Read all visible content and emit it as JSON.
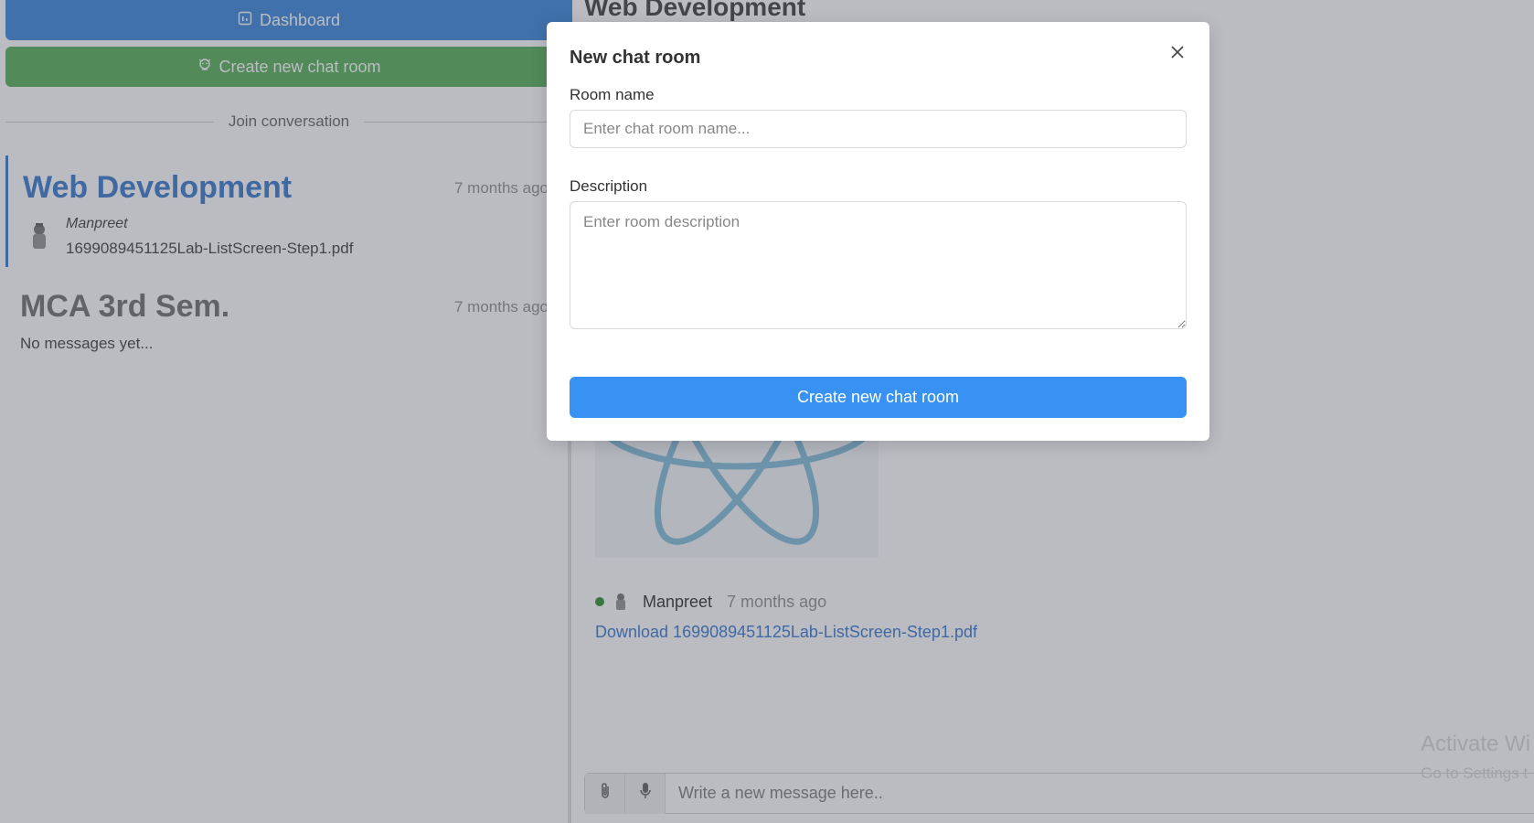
{
  "sidebar": {
    "dashboard_label": "Dashboard",
    "create_label": "Create new chat room",
    "divider_label": "Join conversation",
    "rooms": [
      {
        "title": "Web Development",
        "time": "7 months ago",
        "sender": "Manpreet",
        "last_message": "1699089451125Lab-ListScreen-Step1.pdf"
      },
      {
        "title": "MCA 3rd Sem.",
        "time": "7 months ago",
        "last_message": "No messages yet..."
      }
    ]
  },
  "chat": {
    "title": "Web Development",
    "message": {
      "sender": "Manpreet",
      "time": "7 months ago",
      "link": "Download 1699089451125Lab-ListScreen-Step1.pdf"
    },
    "composer_placeholder": "Write a new message here.."
  },
  "watermark": {
    "line1": "Activate Wi",
    "line2": "Go to Settings t"
  },
  "modal": {
    "title": "New chat room",
    "room_name_label": "Room name",
    "room_name_placeholder": "Enter chat room name...",
    "description_label": "Description",
    "description_placeholder": "Enter room description",
    "submit_label": "Create new chat room"
  },
  "colors": {
    "primary": "#3792f4",
    "dashboard": "#2d7fd6",
    "create": "#4caa4c",
    "active_room": "#2d6ec7",
    "online": "#1f8a1f"
  },
  "icons": {
    "dashboard": "dashboard-icon",
    "create": "chat-room-icon",
    "close": "close-icon",
    "attach": "paperclip-icon",
    "mic": "microphone-icon"
  }
}
